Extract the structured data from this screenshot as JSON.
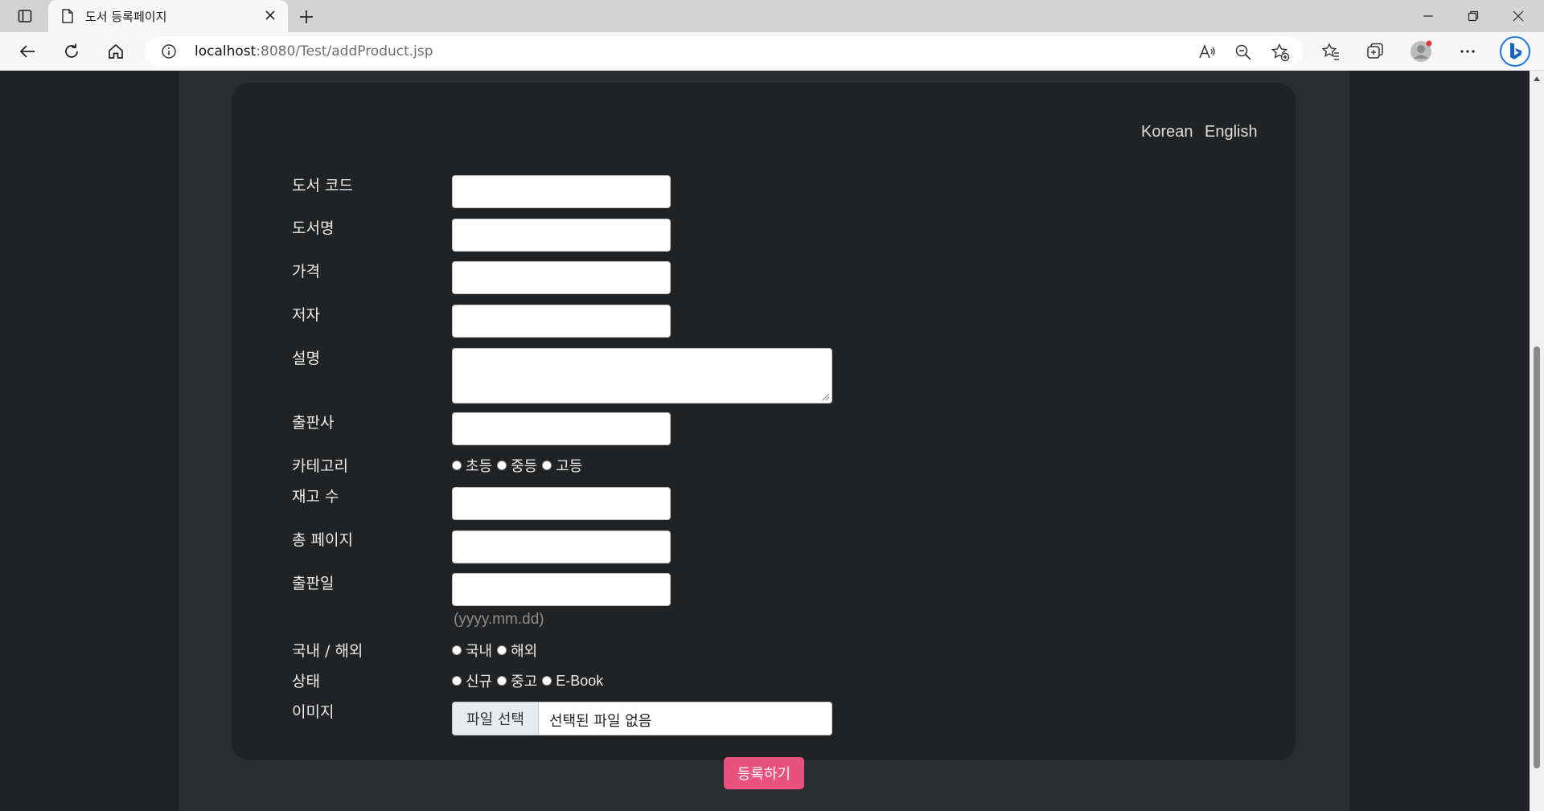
{
  "browser": {
    "tab_title": "도서 등록페이지",
    "url_host": "localhost",
    "url_rest": ":8080/Test/addProduct.jsp"
  },
  "lang": {
    "korean": "Korean",
    "english": "English"
  },
  "form": {
    "book_code_label": "도서 코드",
    "book_name_label": "도서명",
    "price_label": "가격",
    "author_label": "저자",
    "description_label": "설명",
    "publisher_label": "출판사",
    "category_label": "카테고리",
    "category_options": [
      "초등",
      "중등",
      "고등"
    ],
    "stock_label": "재고 수",
    "pages_label": "총 페이지",
    "release_date_label": "출판일",
    "release_date_hint": "(yyyy.mm.dd)",
    "region_label": "국내 / 해외",
    "region_options": [
      "국내",
      "해외"
    ],
    "condition_label": "상태",
    "condition_options": [
      "신규",
      "중고",
      "E-Book"
    ],
    "image_label": "이미지",
    "file_button": "파일 선택",
    "file_status": "선택된 파일 없음",
    "submit": "등록하기"
  },
  "colors": {
    "page_bg": "#202124",
    "card_bg": "#212224",
    "submit_bg": "#e9527f"
  }
}
